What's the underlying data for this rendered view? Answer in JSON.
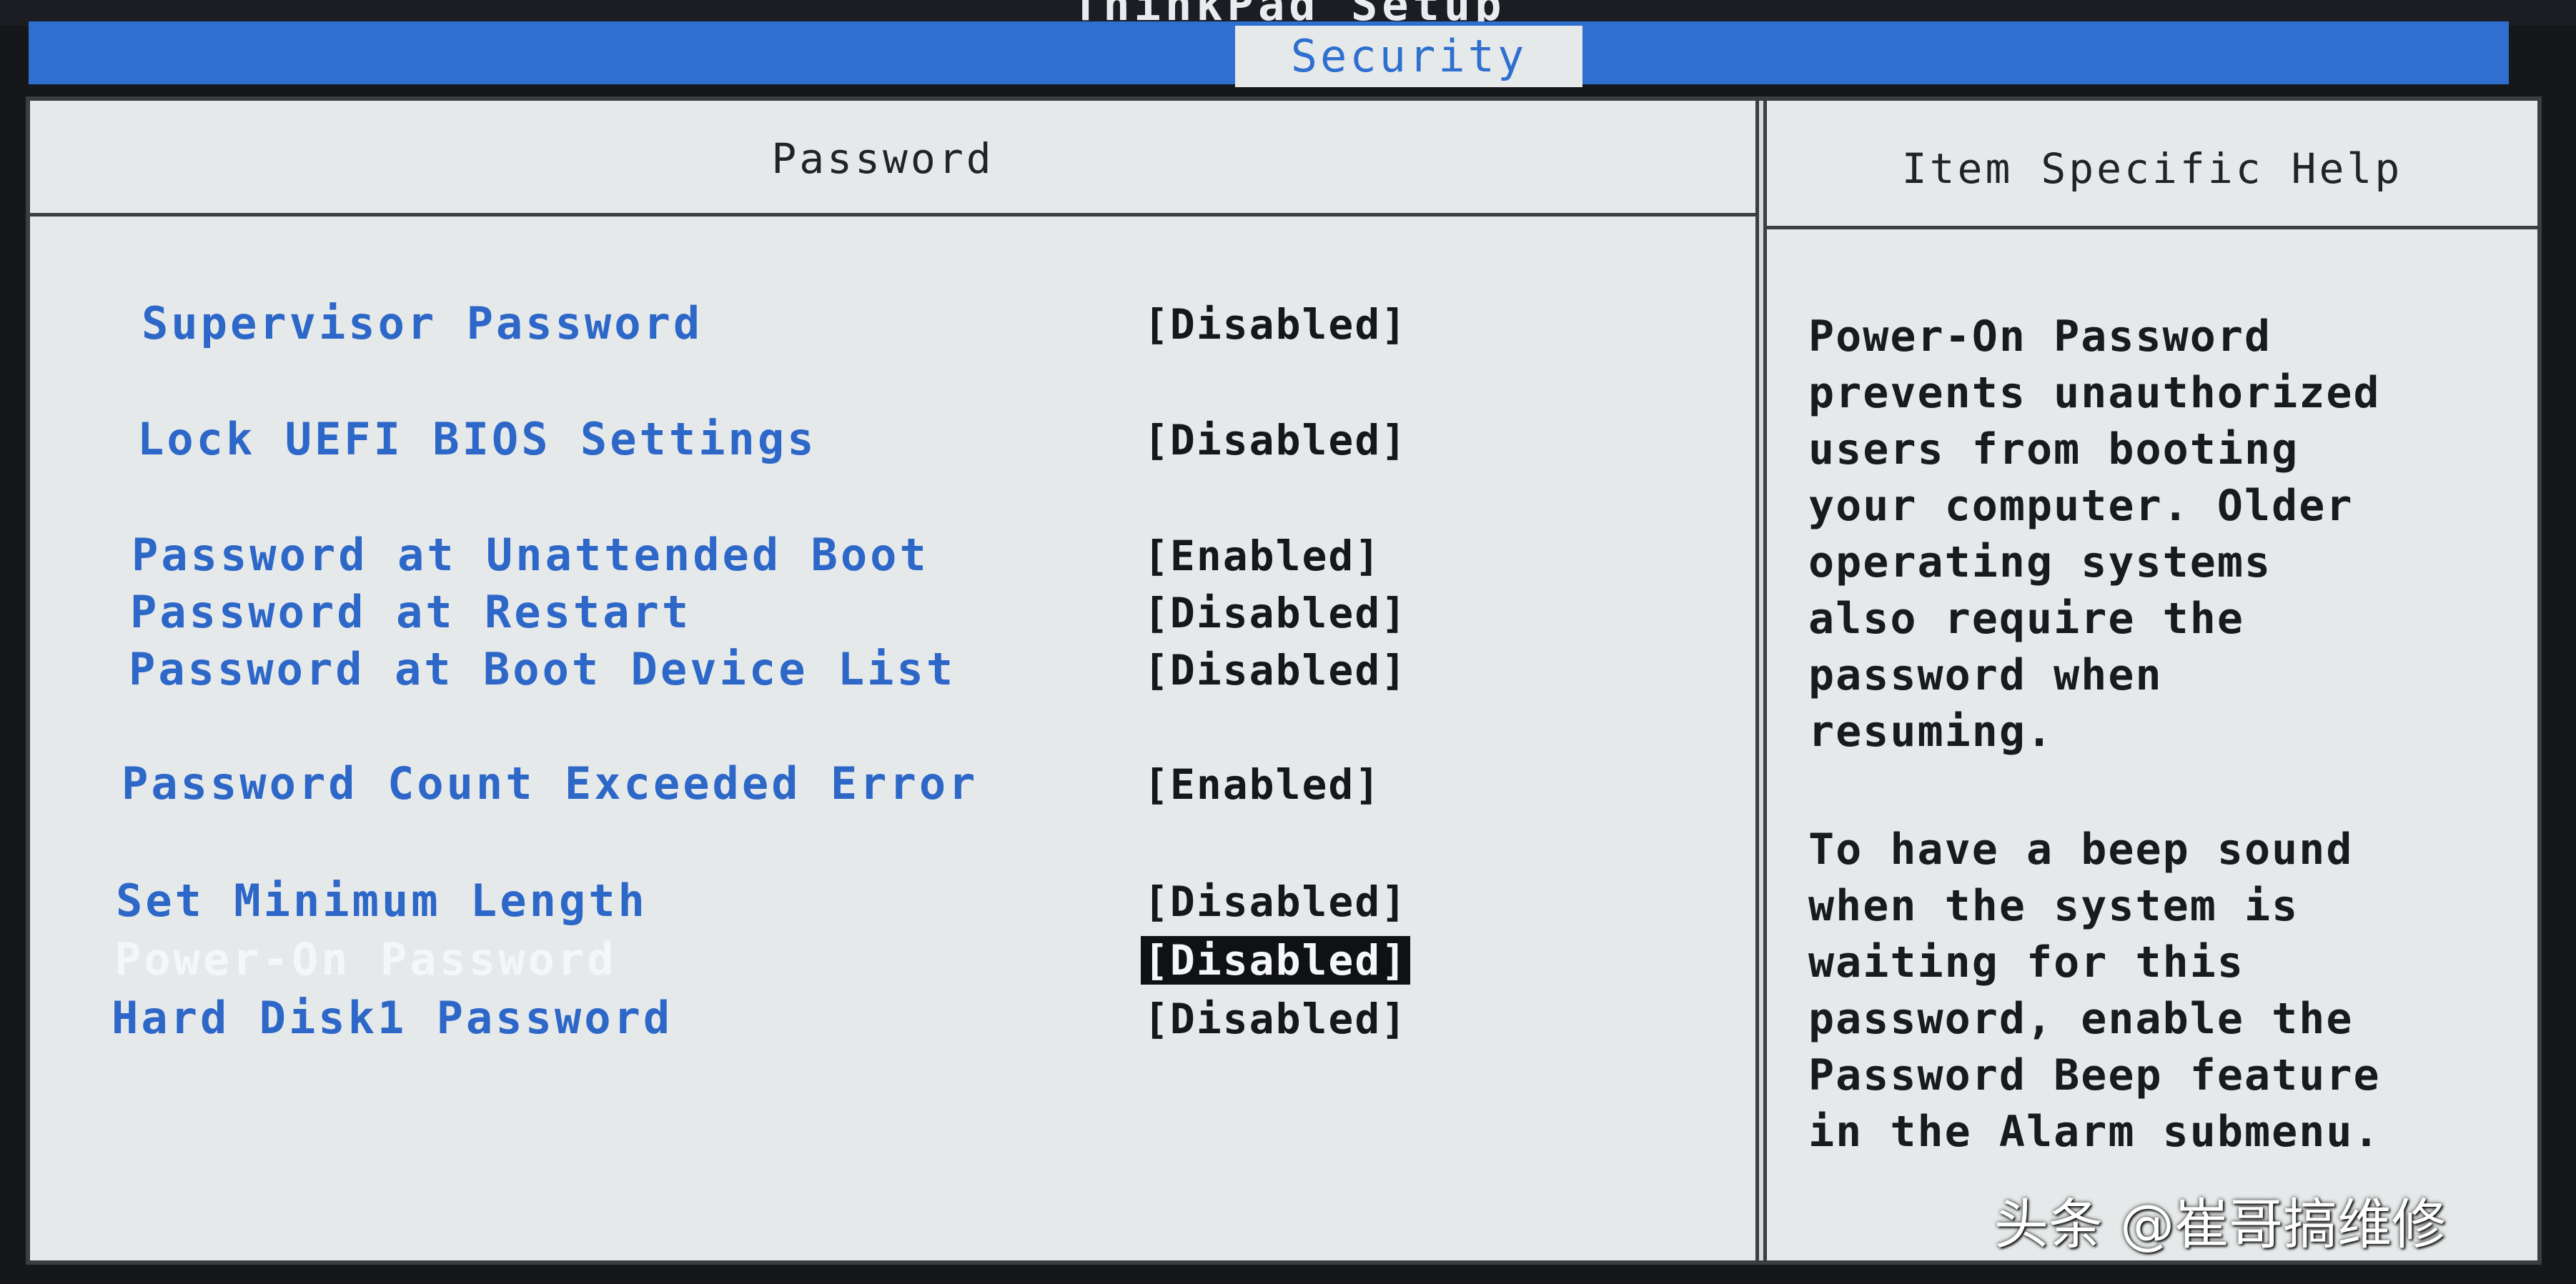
{
  "window": {
    "title": "ThinkPad Setup"
  },
  "tabs": {
    "active": "Security"
  },
  "main": {
    "section_title": "Password",
    "settings": [
      {
        "label": "Supervisor Password",
        "value": "[Disabled]"
      },
      {
        "label": "Lock UEFI BIOS Settings",
        "value": "[Disabled]"
      },
      {
        "label": "Password at Unattended Boot",
        "value": "[Enabled]"
      },
      {
        "label": "Password at Restart",
        "value": "[Disabled]"
      },
      {
        "label": "Password at Boot Device List",
        "value": "[Disabled]"
      },
      {
        "label": "Password Count Exceeded Error",
        "value": "[Enabled]"
      },
      {
        "label": "Set Minimum Length",
        "value": "[Disabled]"
      },
      {
        "label": "Power-On Password",
        "value": "[Disabled]",
        "selected": true
      },
      {
        "label": "Hard Disk1 Password",
        "value": "[Disabled]"
      }
    ]
  },
  "help": {
    "title": "Item Specific Help",
    "paragraph_1": [
      "Power-On Password",
      "prevents unauthorized",
      "users from booting",
      "your computer. Older",
      "operating systems",
      "also require the",
      "password when",
      "resuming."
    ],
    "paragraph_2": [
      "To have a beep sound",
      "when the system is",
      "waiting for this",
      "password, enable the",
      "Password Beep feature",
      "in the Alarm submenu."
    ]
  },
  "watermark": {
    "text": "头条 @崔哥搞维修"
  },
  "colors": {
    "panel_background": "#e6e9ea",
    "accent_blue": "#2f6fd0",
    "label_blue": "#2d67c8",
    "selected_label": "#f5f6f7",
    "value_text": "#15171b",
    "border": "#3a3d42"
  }
}
